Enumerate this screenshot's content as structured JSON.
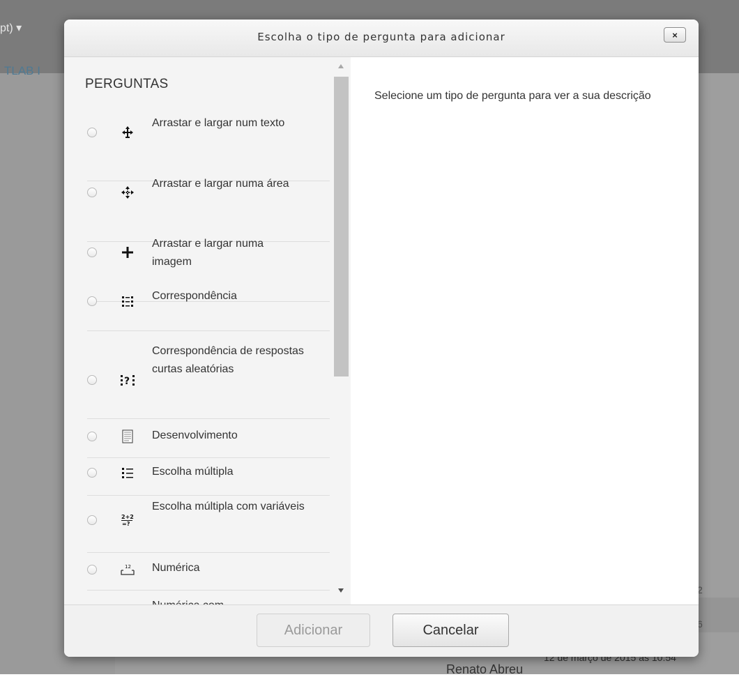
{
  "background": {
    "menu_fragment": "pt) ▾",
    "tab_fragment": "TLAB I",
    "count_fragment_1": "2",
    "count_fragment_2": "6",
    "date_fragment": "12 de março de 2015 às 10:54",
    "author_fragment": "Renato Abreu"
  },
  "dialog": {
    "title": "Escolha o tipo de pergunta para adicionar",
    "close_label": "×",
    "section_heading": "PERGUNTAS",
    "description_placeholder": "Selecione um tipo de pergunta para ver a sua descrição",
    "options": [
      {
        "label": "Arrastar e largar num texto",
        "icon": "drag-drop-text-icon"
      },
      {
        "label": "Arrastar e largar numa área",
        "icon": "drag-drop-area-icon"
      },
      {
        "label": "Arrastar e largar numa imagem",
        "icon": "drag-drop-image-icon"
      },
      {
        "label": "Correspondência",
        "icon": "matching-icon"
      },
      {
        "label": "Correspondência de respostas curtas aleatórias",
        "icon": "random-short-answer-matching-icon"
      },
      {
        "label": "Desenvolvimento",
        "icon": "essay-icon"
      },
      {
        "label": "Escolha múltipla",
        "icon": "multiple-choice-icon"
      },
      {
        "label": "Escolha múltipla com variáveis",
        "icon": "calculated-multichoice-icon"
      },
      {
        "label": "Numérica",
        "icon": "numerical-icon"
      },
      {
        "label": "Numérica com",
        "icon": "calculated-icon"
      }
    ],
    "buttons": {
      "add": "Adicionar",
      "cancel": "Cancelar"
    }
  }
}
